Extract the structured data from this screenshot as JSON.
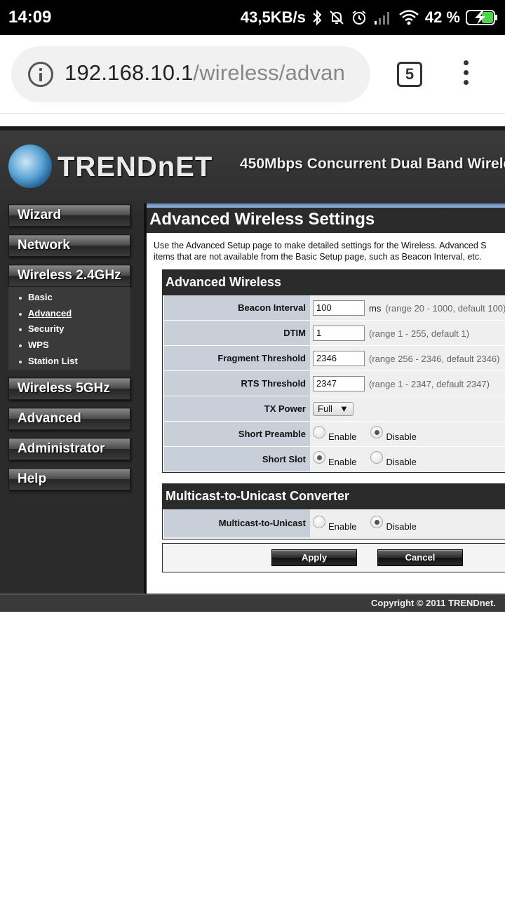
{
  "status_bar": {
    "time": "14:09",
    "net_speed": "43,5KB/s",
    "battery_pct": "42 %",
    "icons": [
      "bluetooth-icon",
      "bell-muted-icon",
      "alarm-icon",
      "signal-icon",
      "wifi-icon",
      "battery-charging-icon"
    ]
  },
  "browser": {
    "url_host": "192.168.10.1",
    "url_path": "/wireless/advan",
    "tab_count": "5"
  },
  "router": {
    "brand": "TRENDnET",
    "slogan": "450Mbps Concurrent Dual Band Wirele",
    "sidebar": {
      "wizard": "Wizard",
      "network": "Network",
      "wireless24": "Wireless 2.4GHz",
      "wireless5": "Wireless 5GHz",
      "advanced": "Advanced",
      "administrator": "Administrator",
      "help": "Help",
      "submenu": [
        "Basic",
        "Advanced",
        "Security",
        "WPS",
        "Station List"
      ]
    },
    "page_title": "Advanced Wireless Settings",
    "intro_line1": "Use the Advanced Setup page to make detailed settings for the Wireless. Advanced S",
    "intro_line2": "items that are not available from the Basic Setup page, such as Beacon Interval, etc.",
    "advanced_wireless": {
      "heading": "Advanced Wireless",
      "beacon_label": "Beacon Interval",
      "beacon_value": "100",
      "beacon_unit": "ms",
      "beacon_hint": "(range 20 - 1000, default 100)",
      "dtim_label": "DTIM",
      "dtim_value": "1",
      "dtim_hint": "(range 1 - 255, default 1)",
      "frag_label": "Fragment Threshold",
      "frag_value": "2346",
      "frag_hint": "(range 256 - 2346, default 2346)",
      "rts_label": "RTS Threshold",
      "rts_value": "2347",
      "rts_hint": "(range 1 - 2347, default 2347)",
      "tx_label": "TX Power",
      "tx_value": "Full",
      "preamble_label": "Short Preamble",
      "slot_label": "Short Slot",
      "enable": "Enable",
      "disable": "Disable"
    },
    "multicast": {
      "heading": "Multicast-to-Unicast Converter",
      "label": "Multicast-to-Unicast",
      "enable": "Enable",
      "disable": "Disable"
    },
    "apply": "Apply",
    "cancel": "Cancel",
    "copyright": "Copyright © 2011 TRENDnet."
  }
}
